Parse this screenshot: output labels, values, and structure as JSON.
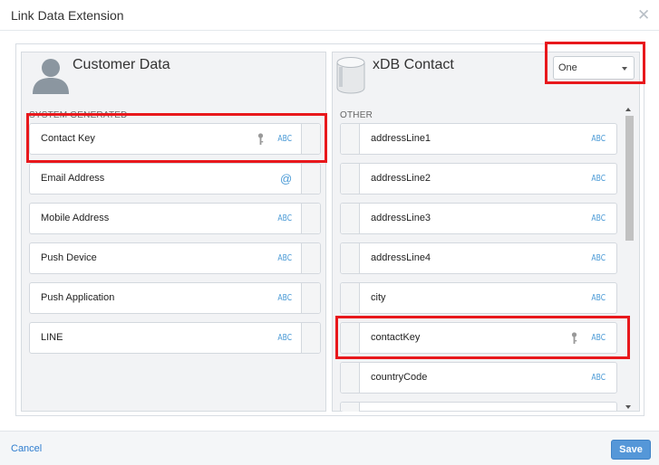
{
  "dialog": {
    "title": "Link Data Extension",
    "close_glyph": "✕"
  },
  "left_panel": {
    "title": "Customer Data",
    "section_label": "SYSTEM GENERATED",
    "icon": "person-icon",
    "rows": [
      {
        "label": "Contact Key",
        "type": "ABC",
        "key": true
      },
      {
        "label": "Email Address",
        "type": "@"
      },
      {
        "label": "Mobile Address",
        "type": "ABC"
      },
      {
        "label": "Push Device",
        "type": "ABC"
      },
      {
        "label": "Push Application",
        "type": "ABC"
      },
      {
        "label": "LINE",
        "type": "ABC"
      }
    ]
  },
  "right_panel": {
    "title": "xDB Contact",
    "section_label": "OTHER",
    "icon": "database-icon",
    "relationship": {
      "selected": "One"
    },
    "rows": [
      {
        "label": "addressLine1",
        "type": "ABC"
      },
      {
        "label": "addressLine2",
        "type": "ABC"
      },
      {
        "label": "addressLine3",
        "type": "ABC"
      },
      {
        "label": "addressLine4",
        "type": "ABC"
      },
      {
        "label": "city",
        "type": "ABC"
      },
      {
        "label": "contactKey",
        "type": "ABC",
        "key": true
      },
      {
        "label": "countryCode",
        "type": "ABC"
      }
    ]
  },
  "footer": {
    "cancel_label": "Cancel",
    "save_label": "Save"
  },
  "colors": {
    "highlight": "#e8181c",
    "type_text": "#4a9ad6",
    "save_button": "#5597d8",
    "link": "#2e7dcf"
  }
}
